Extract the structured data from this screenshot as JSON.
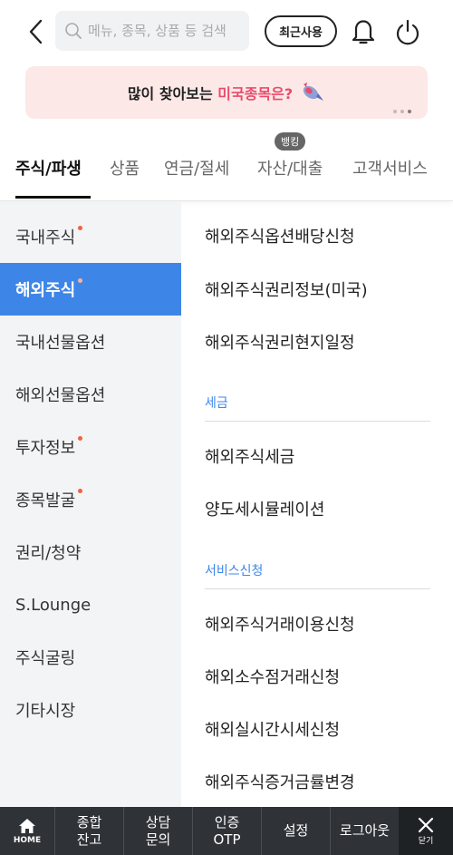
{
  "header": {
    "search_placeholder": "메뉴, 종목, 상품 등 검색",
    "recent_label": "최근사용"
  },
  "banner": {
    "text_prefix": "많이 찾아보는 ",
    "text_highlight": "미국종목은?",
    "highlight_color": "#e74c6a",
    "page_count": 3,
    "active_page": 3
  },
  "category_tabs": {
    "items": [
      {
        "label": "주식/파생",
        "active": true
      },
      {
        "label": "상품",
        "active": false
      },
      {
        "label": "연금/절세",
        "active": false
      },
      {
        "label": "자산/대출",
        "active": false
      },
      {
        "label": "고객서비스",
        "active": false
      }
    ],
    "badge": "뱅킹"
  },
  "sidebar": {
    "items": [
      {
        "label": "국내주식",
        "dot": true
      },
      {
        "label": "해외주식",
        "dot": true,
        "active": true
      },
      {
        "label": "국내선물옵션",
        "dot": false
      },
      {
        "label": "해외선물옵션",
        "dot": false
      },
      {
        "label": "투자정보",
        "dot": true
      },
      {
        "label": "종목발굴",
        "dot": true
      },
      {
        "label": "권리/청약",
        "dot": false
      },
      {
        "label": "S.Lounge",
        "dot": false
      },
      {
        "label": "주식굴링",
        "dot": false
      },
      {
        "label": "기타시장",
        "dot": false
      }
    ],
    "accent_color": "#3d86e8"
  },
  "content": {
    "links_top": [
      "해외주식옵션배당신청",
      "해외주식권리정보(미국)",
      "해외주식권리현지일정"
    ],
    "section_tax": {
      "title": "세금",
      "links": [
        "해외주식세금",
        "양도세시뮬레이션"
      ]
    },
    "section_service": {
      "title": "서비스신청",
      "links": [
        "해외주식거래이용신청",
        "해외소수점거래신청",
        "해외실시간시세신청",
        "해외주식증거금률변경"
      ]
    }
  },
  "bottom_bar": {
    "home_label": "HOME",
    "items": [
      "종합\n잔고",
      "상담\n문의",
      "인증\nOTP",
      "설정",
      "로그아웃"
    ],
    "close_label": "닫기"
  }
}
